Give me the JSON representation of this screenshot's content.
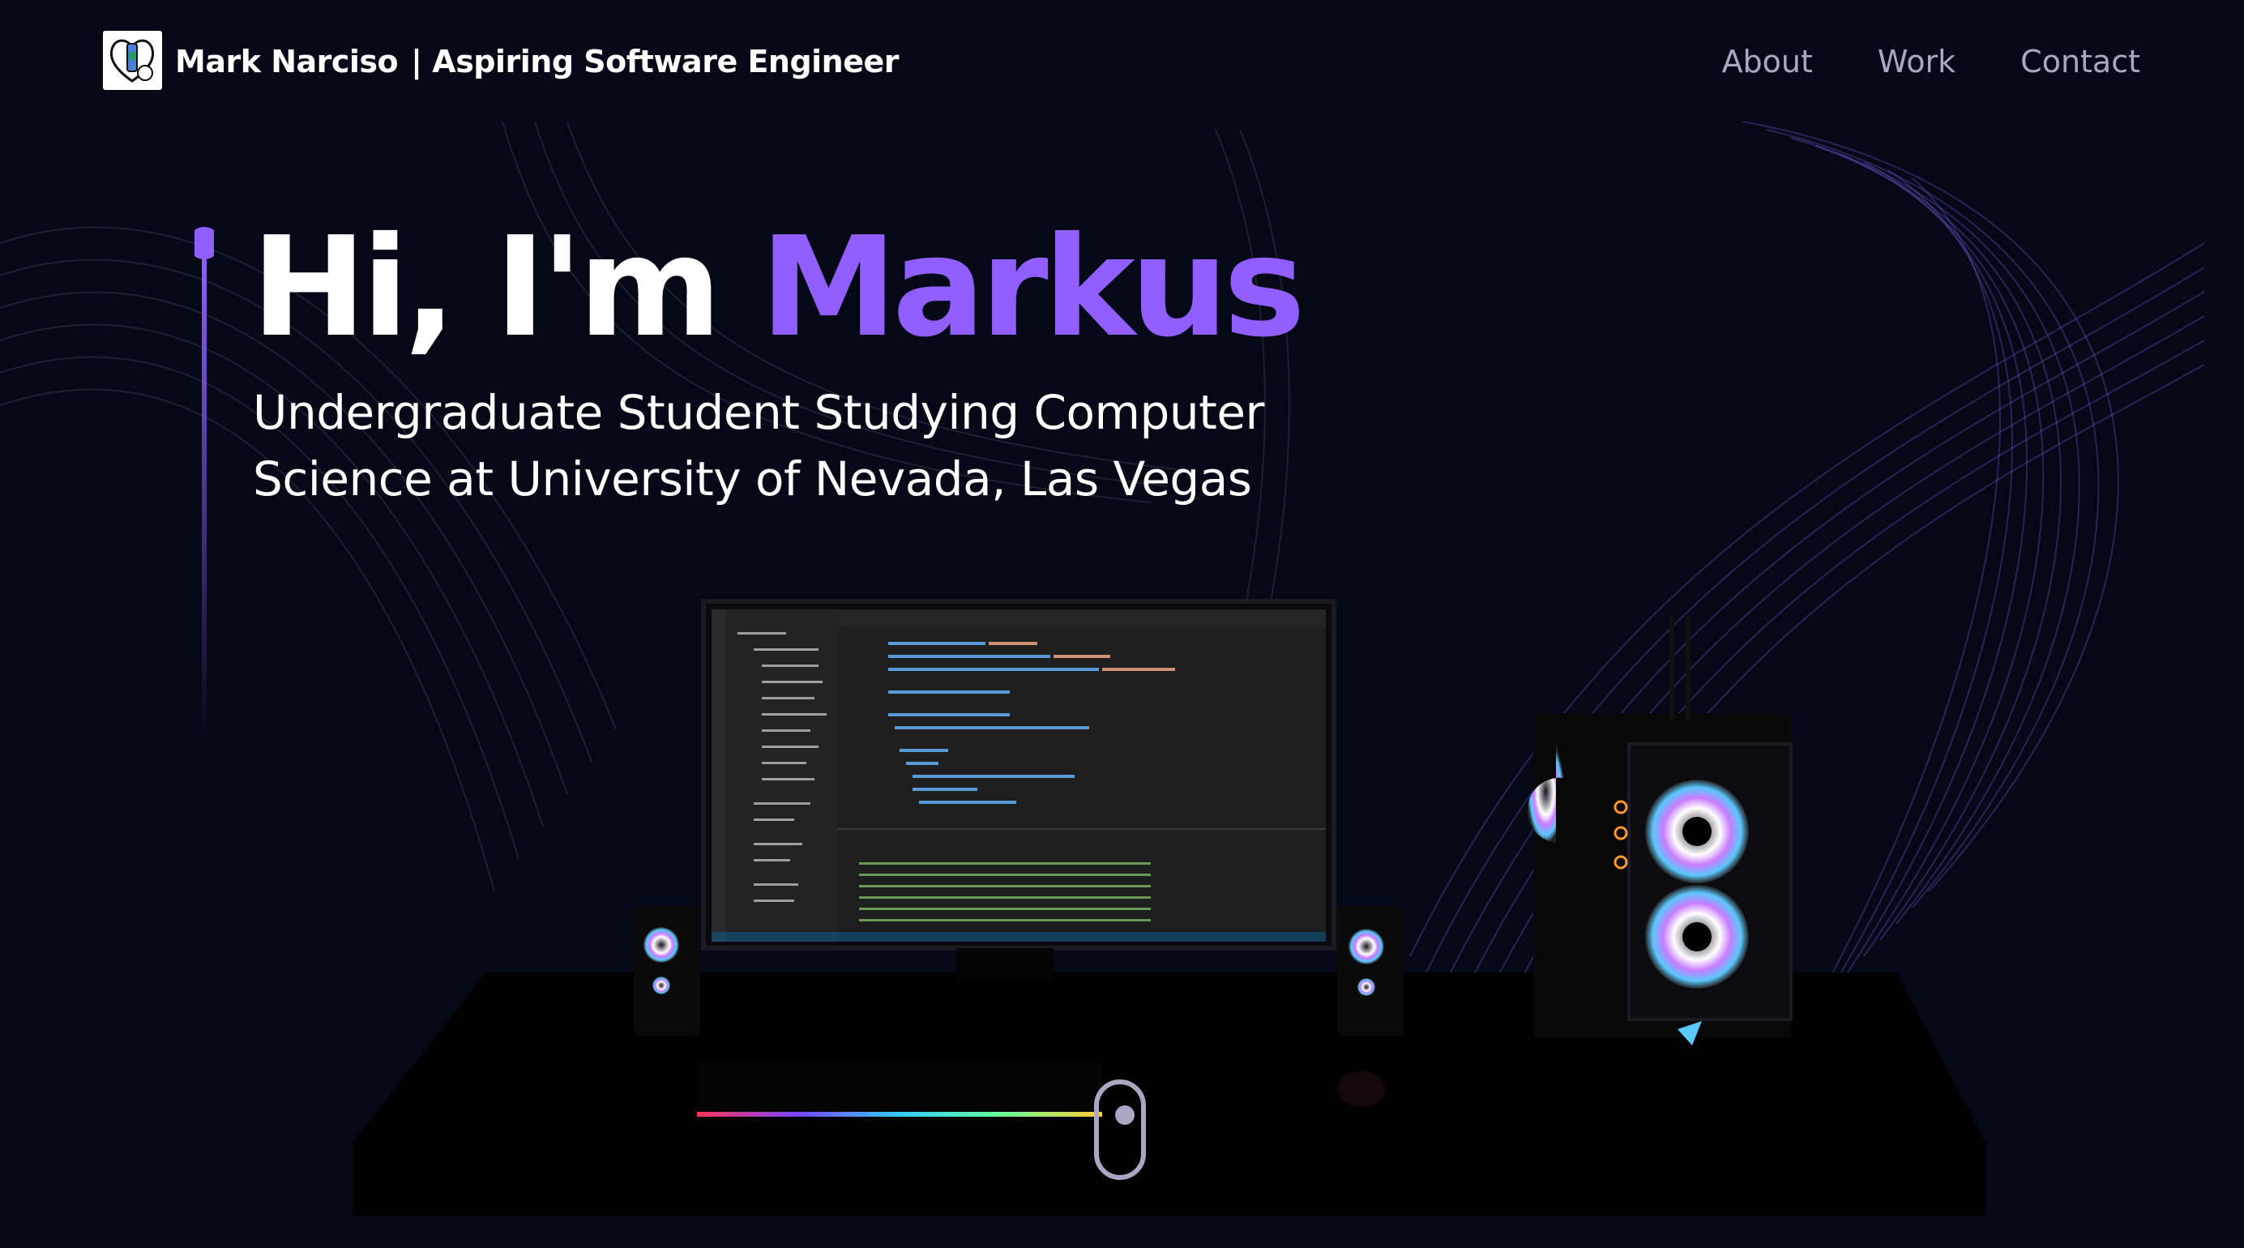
{
  "header": {
    "brand_name": "Mark Narciso",
    "brand_tagline": "| Aspiring Software Engineer",
    "nav": [
      {
        "label": "About"
      },
      {
        "label": "Work"
      },
      {
        "label": "Contact"
      }
    ]
  },
  "hero": {
    "greeting": "Hi, I'm ",
    "name": "Markus",
    "subtitle": "Undergraduate Student Studying Computer Science at University of Nevada, Las Vegas"
  },
  "colors": {
    "background": "#050816",
    "accent": "#915eff",
    "nav_text": "#aaa6c3",
    "text": "#ffffff"
  },
  "icons": {
    "logo": "logo-icon",
    "scroll": "scroll-mouse-icon"
  }
}
